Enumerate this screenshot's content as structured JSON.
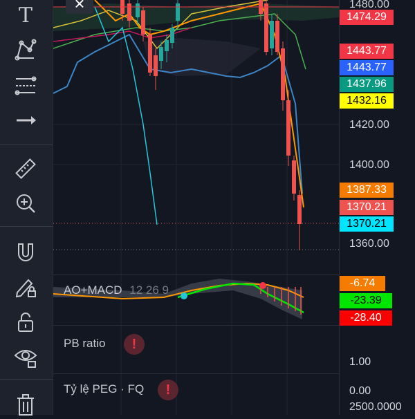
{
  "toolbar": {
    "icons": [
      "text-icon",
      "pattern-icon",
      "fib-icon",
      "arrow-icon",
      "ruler-icon",
      "zoom-icon",
      "magnet-icon",
      "lock-pencil-icon",
      "unlock-icon",
      "eye-icon",
      "trash-icon"
    ],
    "text_tool_label": "T"
  },
  "price_axis": {
    "ticks": [
      "1480.00",
      "1420.00",
      "1400.00",
      "1360.00"
    ],
    "tags": [
      {
        "value": "1474.29",
        "bg": "#f23645",
        "fg": "#ffffff"
      },
      {
        "value": "1443.77",
        "bg": "#f23645",
        "fg": "#ffffff"
      },
      {
        "value": "1443.77",
        "bg": "#2962ff",
        "fg": "#ffffff"
      },
      {
        "value": "1437.96",
        "bg": "#089981",
        "fg": "#ffffff"
      },
      {
        "value": "1432.16",
        "bg": "#ffff00",
        "fg": "#000000"
      },
      {
        "value": "1387.33",
        "bg": "#f57c00",
        "fg": "#ffffff"
      },
      {
        "value": "1370.21",
        "bg": "#ef5350",
        "fg": "#ffffff"
      },
      {
        "value": "1370.21",
        "bg": "#00e5ff",
        "fg": "#000000"
      }
    ]
  },
  "macd": {
    "label": "AO+MACD",
    "params": "12 26 9",
    "tags": [
      {
        "value": "-6.74",
        "bg": "#f57c00",
        "fg": "#ffffff"
      },
      {
        "value": "-23.39",
        "bg": "#00e600",
        "fg": "#000000"
      },
      {
        "value": "-28.40",
        "bg": "#ff0000",
        "fg": "#ffffff"
      }
    ]
  },
  "pb_pane": {
    "label": "PB ratio",
    "axis_value": "1.00",
    "warn": "!"
  },
  "peg_pane": {
    "label": "Tỷ lệ PEG · FQ",
    "axis_value": "0.00",
    "warn": "!"
  },
  "eps_pane": {
    "axis_value": "2500.0000"
  },
  "close_label": "×"
}
